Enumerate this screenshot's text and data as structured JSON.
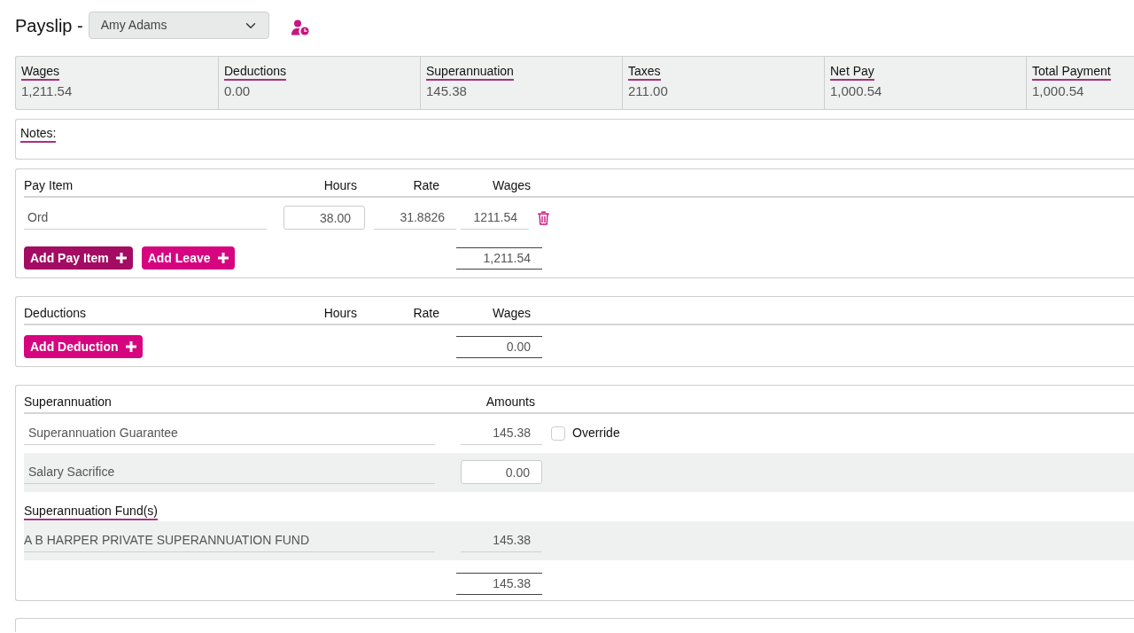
{
  "header": {
    "title": "Payslip -",
    "employee": "Amy Adams"
  },
  "summary": [
    {
      "label": "Wages",
      "value": "1,211.54"
    },
    {
      "label": "Deductions",
      "value": "0.00"
    },
    {
      "label": "Superannuation",
      "value": "145.38"
    },
    {
      "label": "Taxes",
      "value": "211.00"
    },
    {
      "label": "Net Pay",
      "value": "1,000.54"
    },
    {
      "label": "Total Payment",
      "value": "1,000.54"
    }
  ],
  "notes": {
    "label": "Notes:"
  },
  "pay_items": {
    "columns": [
      "Pay Item",
      "Hours",
      "Rate",
      "Wages"
    ],
    "rows": [
      {
        "name": "Ord",
        "hours": "38.00",
        "rate": "31.8826",
        "wages": "1211.54"
      }
    ],
    "buttons": [
      {
        "label": "Add Pay Item",
        "focused": true
      },
      {
        "label": "Add Leave",
        "focused": false
      }
    ],
    "total": "1,211.54"
  },
  "deductions": {
    "columns": [
      "Deductions",
      "Hours",
      "Rate",
      "Wages"
    ],
    "buttons": [
      {
        "label": "Add Deduction",
        "focused": false
      }
    ],
    "total": "0.00"
  },
  "superannuation": {
    "columns": [
      "Superannuation",
      "Amounts"
    ],
    "rows": [
      {
        "kind": "calculated",
        "name": "Superannuation Guarantee",
        "amount": "145.38",
        "override": {
          "label": "Override",
          "checked": false
        }
      },
      {
        "kind": "input",
        "name": "Salary Sacrifice",
        "amount": "0.00"
      }
    ],
    "funds_heading": "Superannuation Fund(s)",
    "funds": [
      {
        "name": "A B HARPER PRIVATE SUPERANNUATION FUND",
        "amount": "145.38"
      }
    ],
    "total": "145.38"
  }
}
